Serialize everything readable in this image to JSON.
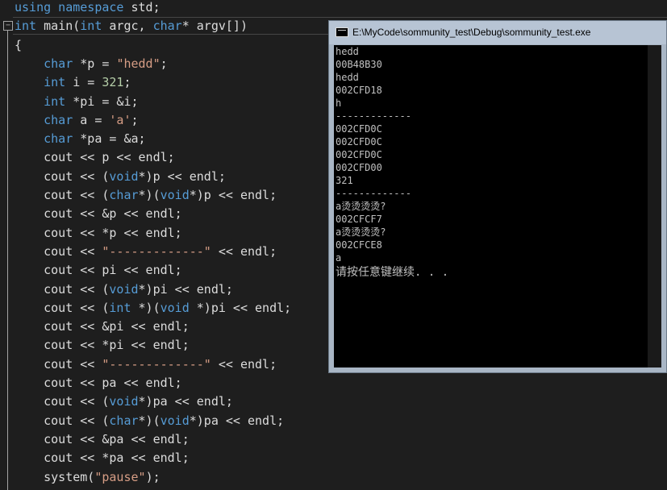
{
  "editor": {
    "collapse_glyph": "−",
    "lines": [
      {
        "segments": [
          {
            "t": "using namespace",
            "c": "kw"
          },
          {
            "t": " std;",
            "c": ""
          }
        ]
      },
      {
        "segments": [
          {
            "t": "int",
            "c": "kw"
          },
          {
            "t": " main(",
            "c": ""
          },
          {
            "t": "int",
            "c": "kw"
          },
          {
            "t": " argc, ",
            "c": ""
          },
          {
            "t": "char",
            "c": "kw"
          },
          {
            "t": "* argv[])",
            "c": ""
          }
        ]
      },
      {
        "segments": [
          {
            "t": "{",
            "c": ""
          }
        ]
      },
      {
        "segments": [
          {
            "t": "    ",
            "c": ""
          },
          {
            "t": "char",
            "c": "kw"
          },
          {
            "t": " *p = ",
            "c": ""
          },
          {
            "t": "\"hedd\"",
            "c": "str"
          },
          {
            "t": ";",
            "c": ""
          }
        ]
      },
      {
        "segments": [
          {
            "t": "    ",
            "c": ""
          },
          {
            "t": "int",
            "c": "kw"
          },
          {
            "t": " i = ",
            "c": ""
          },
          {
            "t": "321",
            "c": "num"
          },
          {
            "t": ";",
            "c": ""
          }
        ]
      },
      {
        "segments": [
          {
            "t": "    ",
            "c": ""
          },
          {
            "t": "int",
            "c": "kw"
          },
          {
            "t": " *pi = &i;",
            "c": ""
          }
        ]
      },
      {
        "segments": [
          {
            "t": "    ",
            "c": ""
          },
          {
            "t": "char",
            "c": "kw"
          },
          {
            "t": " a = ",
            "c": ""
          },
          {
            "t": "'a'",
            "c": "str"
          },
          {
            "t": ";",
            "c": ""
          }
        ]
      },
      {
        "segments": [
          {
            "t": "    ",
            "c": ""
          },
          {
            "t": "char",
            "c": "kw"
          },
          {
            "t": " *pa = &a;",
            "c": ""
          }
        ]
      },
      {
        "segments": [
          {
            "t": "    cout << p << endl;",
            "c": ""
          }
        ]
      },
      {
        "segments": [
          {
            "t": "    cout << (",
            "c": ""
          },
          {
            "t": "void",
            "c": "kw"
          },
          {
            "t": "*)p << endl;",
            "c": ""
          }
        ]
      },
      {
        "segments": [
          {
            "t": "    cout << (",
            "c": ""
          },
          {
            "t": "char",
            "c": "kw"
          },
          {
            "t": "*)(",
            "c": ""
          },
          {
            "t": "void",
            "c": "kw"
          },
          {
            "t": "*)p << endl;",
            "c": ""
          }
        ]
      },
      {
        "segments": [
          {
            "t": "    cout << &p << endl;",
            "c": ""
          }
        ]
      },
      {
        "segments": [
          {
            "t": "    cout << *p << endl;",
            "c": ""
          }
        ]
      },
      {
        "segments": [
          {
            "t": "    cout << ",
            "c": ""
          },
          {
            "t": "\"-------------\"",
            "c": "str"
          },
          {
            "t": " << endl;",
            "c": ""
          }
        ]
      },
      {
        "segments": [
          {
            "t": "    cout << pi << endl;",
            "c": ""
          }
        ]
      },
      {
        "segments": [
          {
            "t": "    cout << (",
            "c": ""
          },
          {
            "t": "void",
            "c": "kw"
          },
          {
            "t": "*)pi << endl;",
            "c": ""
          }
        ]
      },
      {
        "segments": [
          {
            "t": "    cout << (",
            "c": ""
          },
          {
            "t": "int",
            "c": "kw"
          },
          {
            "t": " *)(",
            "c": ""
          },
          {
            "t": "void",
            "c": "kw"
          },
          {
            "t": " *)pi << endl;",
            "c": ""
          }
        ]
      },
      {
        "segments": [
          {
            "t": "    cout << &pi << endl;",
            "c": ""
          }
        ]
      },
      {
        "segments": [
          {
            "t": "    cout << *pi << endl;",
            "c": ""
          }
        ]
      },
      {
        "segments": [
          {
            "t": "    cout << ",
            "c": ""
          },
          {
            "t": "\"-------------\"",
            "c": "str"
          },
          {
            "t": " << endl;",
            "c": ""
          }
        ]
      },
      {
        "segments": [
          {
            "t": "    cout << pa << endl;",
            "c": ""
          }
        ]
      },
      {
        "segments": [
          {
            "t": "    cout << (",
            "c": ""
          },
          {
            "t": "void",
            "c": "kw"
          },
          {
            "t": "*)pa << endl;",
            "c": ""
          }
        ]
      },
      {
        "segments": [
          {
            "t": "    cout << (",
            "c": ""
          },
          {
            "t": "char",
            "c": "kw"
          },
          {
            "t": "*)(",
            "c": ""
          },
          {
            "t": "void",
            "c": "kw"
          },
          {
            "t": "*)pa << endl;",
            "c": ""
          }
        ]
      },
      {
        "segments": [
          {
            "t": "    cout << &pa << endl;",
            "c": ""
          }
        ]
      },
      {
        "segments": [
          {
            "t": "    cout << *pa << endl;",
            "c": ""
          }
        ]
      },
      {
        "segments": [
          {
            "t": "    system(",
            "c": ""
          },
          {
            "t": "\"pause\"",
            "c": "str"
          },
          {
            "t": ");",
            "c": ""
          }
        ]
      }
    ]
  },
  "console": {
    "title": "E:\\MyCode\\sommunity_test\\Debug\\sommunity_test.exe",
    "icon": "console-app-icon",
    "output": [
      "hedd",
      "00B48B30",
      "hedd",
      "002CFD18",
      "h",
      "-------------",
      "002CFD0C",
      "002CFD0C",
      "002CFD0C",
      "002CFD00",
      "321",
      "-------------",
      "a烫烫烫烫?",
      "002CFCF7",
      "a烫烫烫烫?",
      "002CFCE8",
      "a",
      "请按任意键继续. . ."
    ]
  },
  "colors": {
    "editor_bg": "#1e1e1e",
    "keyword": "#569cd6",
    "string": "#d69d85",
    "number": "#b5cea8",
    "text": "#dcdcdc",
    "console_bg": "#000000",
    "console_text": "#c0c0c0"
  }
}
